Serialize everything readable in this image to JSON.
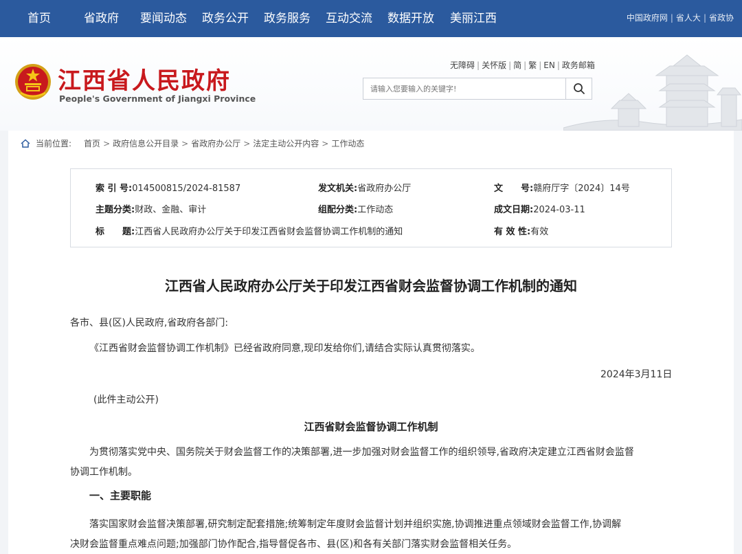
{
  "topnav": {
    "items": [
      "首页",
      "省政府",
      "要闻动态",
      "政务公开",
      "政务服务",
      "互动交流",
      "数据开放",
      "美丽江西"
    ],
    "right_links": [
      "中国政府网",
      "省人大",
      "省政协"
    ]
  },
  "header": {
    "title": "江西省人民政府",
    "subtitle": "People's Government of Jiangxi Province",
    "util_links": [
      "无障碍",
      "关怀版",
      "简",
      "繁",
      "EN",
      "政务邮箱"
    ],
    "search_placeholder": "请输入您要输入的关键字!"
  },
  "breadcrumb": {
    "label": "当前位置:",
    "items": [
      "首页",
      "政府信息公开目录",
      "省政府办公厅",
      "法定主动公开内容",
      "工作动态"
    ]
  },
  "meta": {
    "index_label": "索 引 号:",
    "index_value": "014500815/2024-81587",
    "issuer_label": "发文机关:",
    "issuer_value": "省政府办公厅",
    "docno_label": "文　　号:",
    "docno_value": "赣府厅字〔2024〕14号",
    "topic_label": "主题分类:",
    "topic_value": "财政、金融、审计",
    "category_label": "组配分类:",
    "category_value": "工作动态",
    "date_label": "成文日期:",
    "date_value": "2024-03-11",
    "title_label": "标　　题:",
    "title_value": "江西省人民政府办公厅关于印发江西省财会监督协调工作机制的通知",
    "validity_label": "有 效 性:",
    "validity_value": "有效"
  },
  "document": {
    "title": "江西省人民政府办公厅关于印发江西省财会监督协调工作机制的通知",
    "addressee": "各市、县(区)人民政府,省政府各部门:",
    "para1": "《江西省财会监督协调工作机制》已经省政府同意,现印发给你们,请结合实际认真贯彻落实。",
    "date": "2024年3月11日",
    "public_note": "(此件主动公开)",
    "sub_title": "江西省财会监督协调工作机制",
    "para2_line1": "为贯彻落实党中央、国务院关于财会监督工作的决策部署,进一步加强对财会监督工作的组织领导,省政府决定建立江西省财会监督",
    "para2_line2": "协调工作机制。",
    "section1": "一、主要职能",
    "para3_line1": "落实国家财会监督决策部署,研究制定配套措施;统筹制定年度财会监督计划并组织实施,协调推进重点领域财会监督工作,协调解",
    "para3_line2": "决财会监督重点难点问题;加强部门协作配合,指导督促各市、县(区)和各有关部门落实财会监督相关任务。"
  }
}
